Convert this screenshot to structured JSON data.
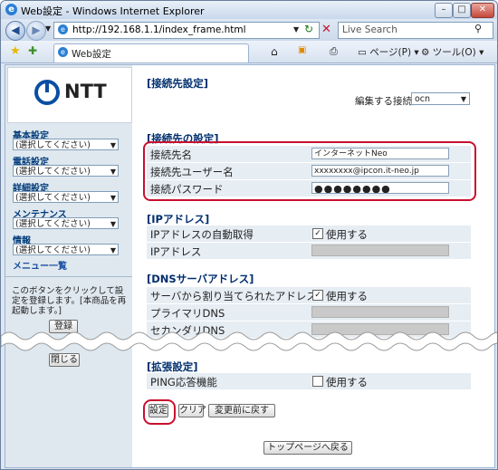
{
  "window": {
    "title": "Web設定 - Windows Internet Explorer",
    "url": "http://192.168.1.1/index_frame.html",
    "search_placeholder": "Live Search",
    "tab_label": "Web設定",
    "toolbar": {
      "page_menu": "ページ(P)",
      "tools_menu": "ツール(O)"
    }
  },
  "sidebar": {
    "logo_text": "NTT",
    "items": [
      {
        "label": "基本設定",
        "select": "(選択してください)"
      },
      {
        "label": "電話設定",
        "select": "(選択してください)"
      },
      {
        "label": "詳細設定",
        "select": "(選択してください)"
      },
      {
        "label": "メンテナンス",
        "select": "(選択してください)"
      },
      {
        "label": "情報",
        "select": "(選択してください)"
      }
    ],
    "menu_link": "メニュー一覧",
    "note": "このボタンをクリックして設定を登録します。[本商品を再起動します。]",
    "register_button": "登録",
    "close_button": "閉じる"
  },
  "main": {
    "page_title": "[接続先設定]",
    "edit_target_label": "編集する接続先",
    "edit_target_value": "ocn",
    "connection": {
      "heading": "[接続先の設定]",
      "rows": [
        {
          "label": "接続先名",
          "value": "インターネットNeo"
        },
        {
          "label": "接続先ユーザー名",
          "value": "xxxxxxxx@ipcon.it-neo.jp"
        },
        {
          "label": "接続パスワード",
          "value": "●●●●●●●●"
        }
      ]
    },
    "ip": {
      "heading": "[IPアドレス]",
      "auto_label": "IPアドレスの自動取得",
      "auto_check": "使用する",
      "address_label": "IPアドレス"
    },
    "dns": {
      "heading": "[DNSサーバアドレス]",
      "auto_label": "サーバから割り当てられたアドレス",
      "auto_check": "使用する",
      "primary_label": "プライマリDNS",
      "secondary_label": "セカンダリDNS"
    },
    "extended": {
      "heading": "[拡張設定]",
      "ping_label": "PING応答機能",
      "ping_check": "使用する"
    },
    "buttons": {
      "set": "設定",
      "clear": "クリア",
      "revert": "変更前に戻す",
      "top": "トップページへ戻る"
    }
  },
  "colors": {
    "accent_red": "#c8102e",
    "logo_blue": "#0a4ea2",
    "heading_blue": "#002e6e"
  }
}
